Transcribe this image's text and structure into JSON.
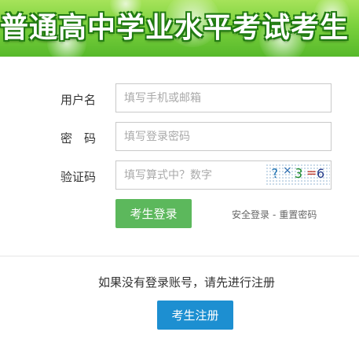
{
  "banner": {
    "title": "普通高中学业水平考试考生"
  },
  "form": {
    "username": {
      "label": "用户名",
      "placeholder": "填写手机或邮箱",
      "value": ""
    },
    "password": {
      "label": "密　码",
      "placeholder": "填写登录密码",
      "value": ""
    },
    "captcha": {
      "label": "验证码",
      "placeholder": "填写算式中？数字",
      "value": "",
      "image_chars": [
        "?",
        "×",
        "3",
        "=",
        "6"
      ]
    }
  },
  "actions": {
    "login_label": "考生登录",
    "safe_login_link": "安全登录",
    "separator": "-",
    "reset_password_link": "重置密码"
  },
  "register": {
    "hint": "如果没有登录账号，请先进行注册",
    "button_label": "考生注册"
  },
  "colors": {
    "banner_green": "#7bd13d",
    "login_button": "#5cb85c",
    "register_button": "#1d8fd1"
  }
}
